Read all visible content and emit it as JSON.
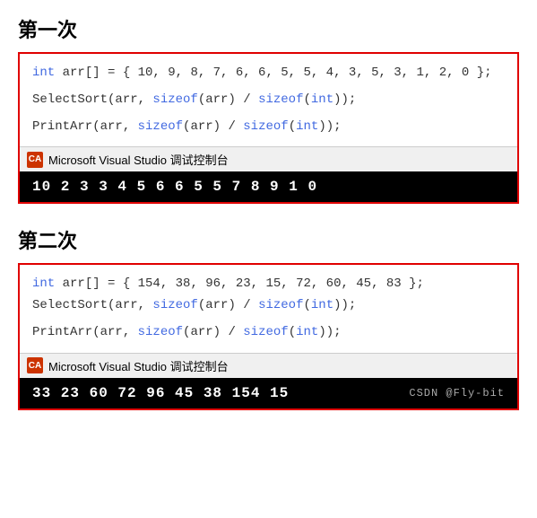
{
  "section1": {
    "title": "第一次",
    "code_lines": [
      "int arr[] = { 10, 9, 8, 7, 6, 6, 5, 5, 4, 3, 5, 3, 1, 2, 0 };",
      "",
      "SelectSort(arr, sizeof(arr) / sizeof(int));",
      "",
      "PrintArr(arr, sizeof(arr) / sizeof(int));"
    ],
    "console_label": "Microsoft Visual Studio 调试控制台",
    "console_output": "10 2 3 3 4 5 6 6 5 5 7 8 9 1 0"
  },
  "section2": {
    "title": "第二次",
    "code_lines": [
      "int arr[] = { 154, 38, 96, 23, 15, 72, 60, 45, 83 };",
      "SelectSort(arr, sizeof(arr) / sizeof(int));",
      "",
      "PrintArr(arr, sizeof(arr) / sizeof(int));"
    ],
    "console_label": "Microsoft Visual Studio 调试控制台",
    "console_output": "33 23 60 72 96 45 38 154 15"
  },
  "watermark": "CSDN @Fly-bit",
  "icons": {
    "console": "CA"
  }
}
